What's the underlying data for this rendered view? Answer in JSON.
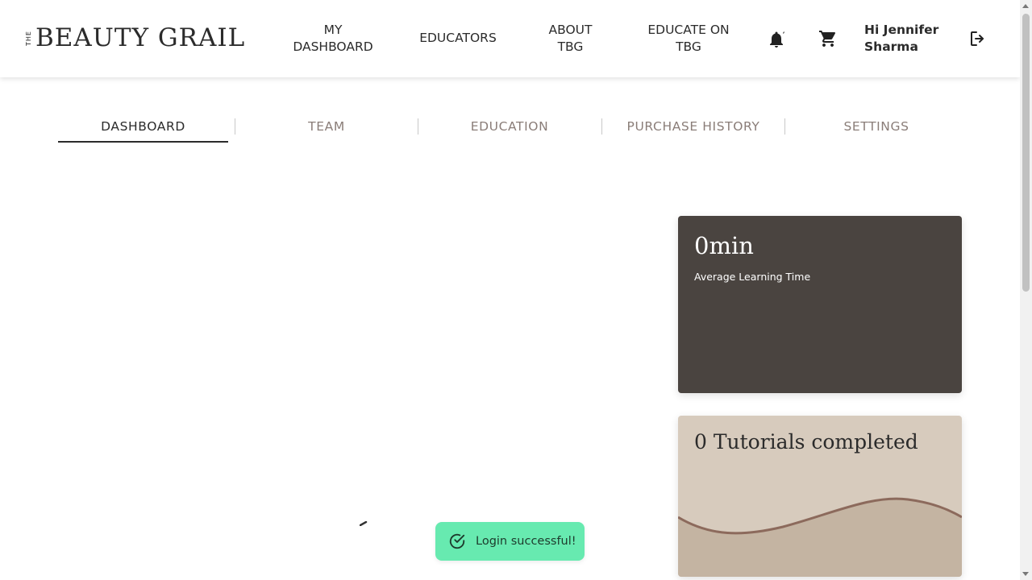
{
  "header": {
    "logo_prefix": "THE",
    "logo_text": "BEAUTY GRAIL",
    "nav": {
      "my_dashboard": "MY DASHBOARD",
      "educators": "EDUCATORS",
      "about": "ABOUT TBG",
      "educate": "EDUCATE ON TBG"
    },
    "greeting": "Hi Jennifer Sharma",
    "icons": {
      "notifications": "bell-icon",
      "cart": "cart-icon",
      "logout": "logout-icon"
    }
  },
  "tabs": [
    {
      "label": "DASHBOARD",
      "active": true
    },
    {
      "label": "TEAM",
      "active": false
    },
    {
      "label": "EDUCATION",
      "active": false
    },
    {
      "label": "PURCHASE HISTORY",
      "active": false
    },
    {
      "label": "SETTINGS",
      "active": false
    }
  ],
  "cards": {
    "learning_time": {
      "value": "0min",
      "label": "Average Learning Time"
    },
    "tutorials": {
      "value": "0 Tutorials completed"
    }
  },
  "toast": {
    "message": "Login successful!"
  },
  "colors": {
    "dark_card": "#4a4440",
    "beige_card": "#d7cbbd",
    "wave": "#8c6a5c",
    "toast_bg": "#67eab0"
  }
}
